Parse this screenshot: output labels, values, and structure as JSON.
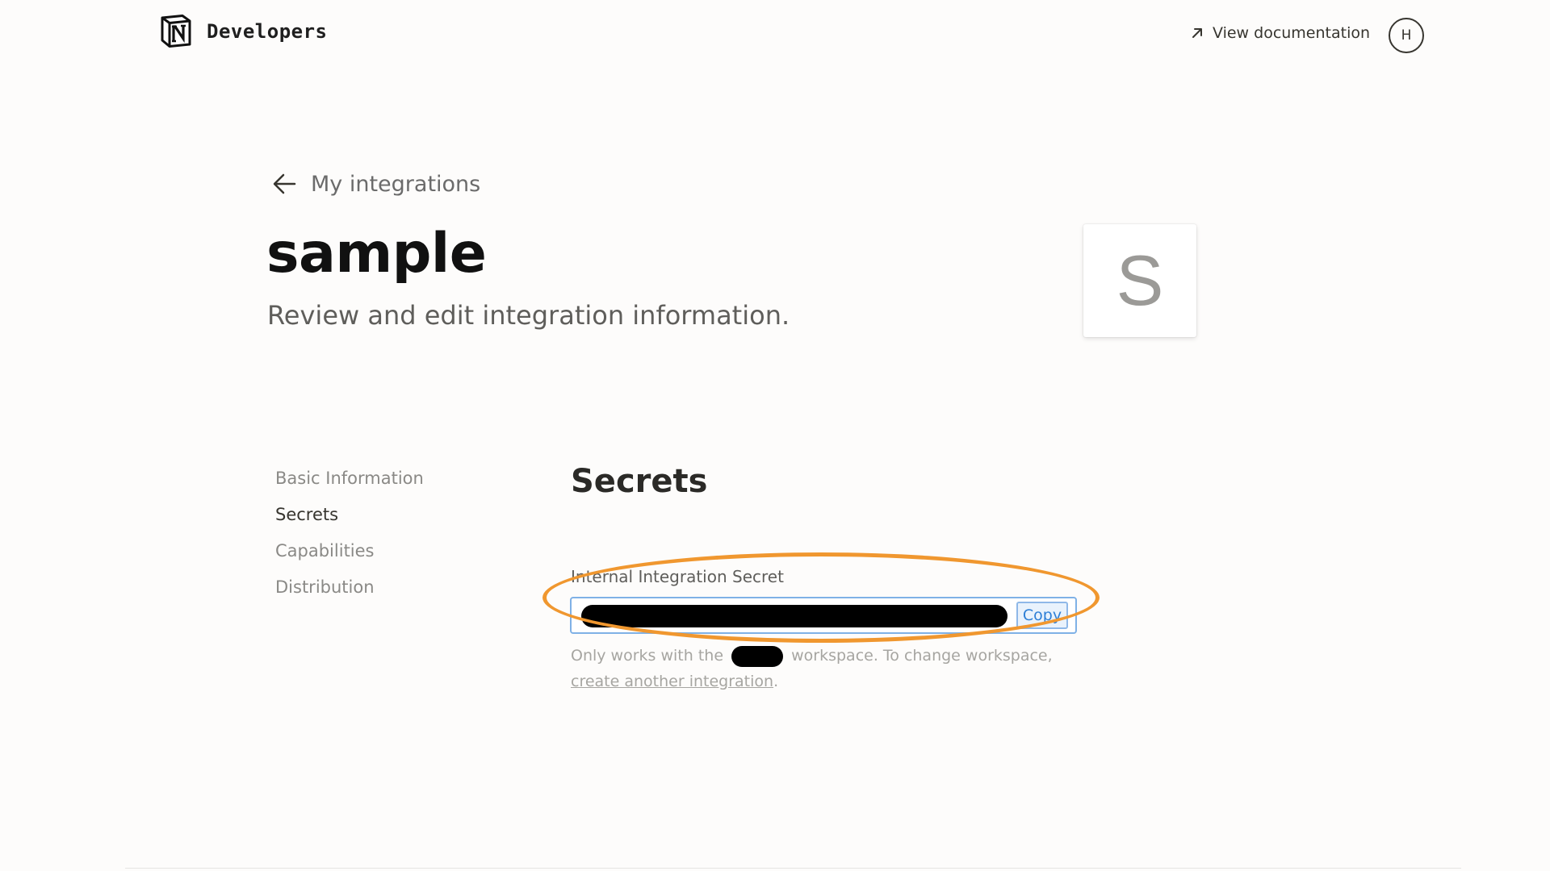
{
  "header": {
    "brand": "Developers",
    "logo_icon": "notion-logo-icon",
    "docs_label": "View documentation",
    "docs_icon": "external-arrow-icon",
    "avatar_initial": "H"
  },
  "back": {
    "label": "My integrations",
    "icon": "arrow-left-icon"
  },
  "page": {
    "title": "sample",
    "subtitle": "Review and edit integration information.",
    "icon_letter": "S"
  },
  "nav": {
    "items": [
      {
        "label": "Basic Information",
        "active": false
      },
      {
        "label": "Secrets",
        "active": true
      },
      {
        "label": "Capabilities",
        "active": false
      },
      {
        "label": "Distribution",
        "active": false
      }
    ]
  },
  "section": {
    "title": "Secrets",
    "field_label": "Internal Integration Secret",
    "copy_label": "Copy",
    "help_prefix": "Only works with the",
    "help_suffix": "workspace. To change workspace,",
    "help_link": "create another integration",
    "help_end": "."
  },
  "colors": {
    "accent_blue": "#2e7fd6",
    "highlight_orange": "#f0972f",
    "background": "#fdfcfb"
  }
}
